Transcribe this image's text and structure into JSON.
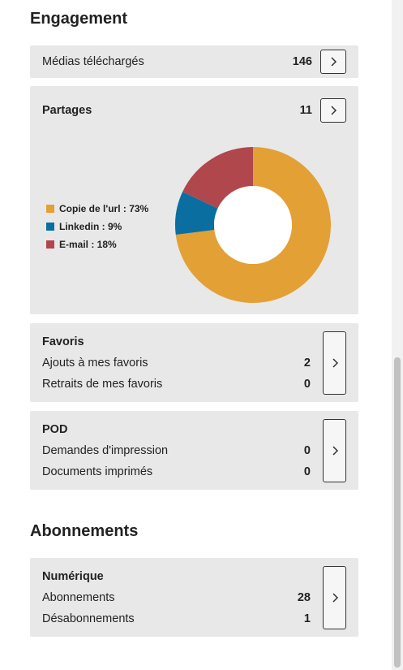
{
  "engagement": {
    "title": "Engagement",
    "medias": {
      "label": "Médias téléchargés",
      "value": "146"
    },
    "partages": {
      "label": "Partages",
      "value": "11",
      "legend": [
        {
          "label": "Copie de l'url : 73%",
          "color": "#e3a035",
          "percent": 73
        },
        {
          "label": "Linkedin : 9%",
          "color": "#0a6fa0",
          "percent": 9
        },
        {
          "label": "E-mail : 18%",
          "color": "#b0474d",
          "percent": 18
        }
      ]
    },
    "favoris": {
      "title": "Favoris",
      "rows": [
        {
          "label": "Ajouts à mes favoris",
          "value": "2"
        },
        {
          "label": "Retraits de mes favoris",
          "value": "0"
        }
      ]
    },
    "pod": {
      "title": "POD",
      "rows": [
        {
          "label": "Demandes d'impression",
          "value": "0"
        },
        {
          "label": "Documents imprimés",
          "value": "0"
        }
      ]
    }
  },
  "abonnements": {
    "title": "Abonnements",
    "numerique": {
      "title": "Numérique",
      "rows": [
        {
          "label": "Abonnements",
          "value": "28"
        },
        {
          "label": "Désabonnements",
          "value": "1"
        }
      ]
    }
  },
  "icons": {
    "arrow": "chevron-right-icon"
  }
}
